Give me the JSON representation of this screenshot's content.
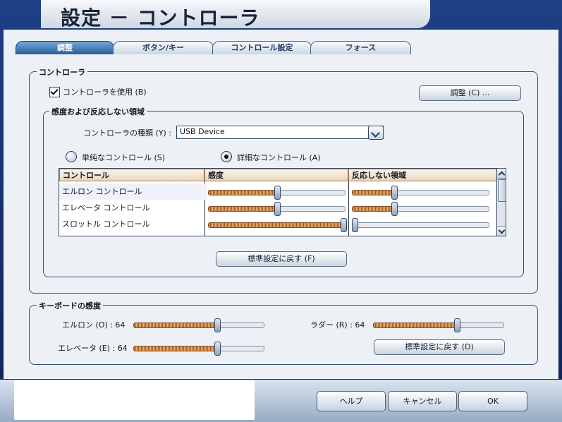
{
  "window": {
    "title": "設定 － コントローラ"
  },
  "tabs": [
    {
      "label": "調整",
      "active": true
    },
    {
      "label": "ボタン/キー",
      "active": false
    },
    {
      "label": "コントロール設定",
      "active": false
    },
    {
      "label": "フォース",
      "active": false
    }
  ],
  "controller_group": {
    "title": "コントローラ",
    "use_controller_label": "コントローラを使用 (B)",
    "use_controller_checked": true,
    "calibrate_button": "調整 (C) ..."
  },
  "sensitivity_group": {
    "title": "感度および反応しない領域",
    "controller_type_label": "コントローラの種類 (Y) :",
    "controller_type_value": "USB Device",
    "simple_control_label": "単純なコントロール (S)",
    "detailed_control_label": "詳細なコントロール (A)",
    "selected_mode": "detailed",
    "table_headers": [
      "コントロール",
      "感度",
      "反応しない領域"
    ],
    "rows": [
      {
        "label": "エルロン コントロール",
        "sensitivity": 0.5,
        "deadzone": 0.3
      },
      {
        "label": "エレベータ コントロール",
        "sensitivity": 0.5,
        "deadzone": 0.3
      },
      {
        "label": "スロットル コントロール",
        "sensitivity": 1.0,
        "deadzone": 0.0
      }
    ],
    "reset_button": "標準設定に戻す (F)"
  },
  "keyboard_group": {
    "title": "キーボードの感度",
    "aileron_label": "エルロン (O) : 64",
    "aileron_value": 64,
    "elevator_label": "エレベータ (E) : 64",
    "elevator_value": 64,
    "rudder_label": "ラダー (R) : 64",
    "rudder_value": 64,
    "reset_button": "標準設定に戻す (D)"
  },
  "footer": {
    "help": "ヘルプ",
    "cancel": "キャンセル",
    "ok": "OK"
  },
  "colors": {
    "frame": "#0c2357",
    "active_tab": "#2b5d98",
    "slider_fill": "#e2b16d"
  }
}
